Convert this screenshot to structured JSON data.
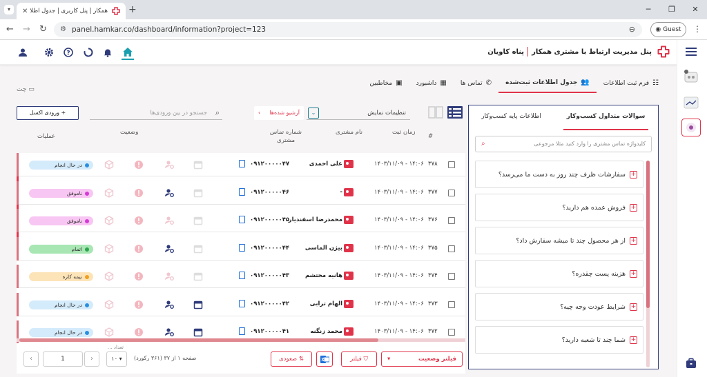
{
  "browser": {
    "tab_title": "همکار | پنل کاربری | جدول اطلاعا...",
    "url": "panel.hamkar.co/dashboard/information?project=123",
    "profile_label": "Guest"
  },
  "header": {
    "brand_title": "پنل مدیریت ارتباط با مشتری همکار",
    "company": "پناه کاویان"
  },
  "nav_tabs": [
    {
      "label": "فرم ثبت اطلاعات",
      "icon": "form-icon"
    },
    {
      "label": "جدول اطلاعات ثبت‌شده",
      "icon": "users-icon",
      "active": true
    },
    {
      "label": "تماس ها",
      "icon": "phone-icon"
    },
    {
      "label": "داشبورد",
      "icon": "dashboard-icon"
    },
    {
      "label": "مخاطبین",
      "icon": "contacts-icon"
    }
  ],
  "chat_label": "چت",
  "toolbar": {
    "excel_button": "ورودی اکسل",
    "search_placeholder": "جستجو در بین ورودی‌ها",
    "archive_label": "آرشیو شده‌ها",
    "display_settings": "تنظیمات نمایش"
  },
  "table": {
    "headers": {
      "index": "#",
      "time": "زمان ثبت",
      "name": "نام مشتری",
      "phone": "شماره تماس مشتری",
      "status": "وضعیت",
      "actions": "عملیات"
    },
    "rows": [
      {
        "id": "۳۷۸",
        "time": "۱۴۰۳/۱۱/۰۹ - ۱۴:۰۶",
        "name": "علی احمدی",
        "phone": "۰۹۱۲۰۰۰۰۰۴۷",
        "status": "در حال انجام",
        "status_color": "#2b8fe0",
        "badge_bg": "#d4ebfb"
      },
      {
        "id": "۳۷۷",
        "time": "۱۴۰۳/۱۱/۰۹ - ۱۴:۰۶",
        "name": "-",
        "phone": "۰۹۱۲۰۰۰۰۰۴۶",
        "status": "ناموفق",
        "status_color": "#d63ad6",
        "badge_bg": "#f8c6f3"
      },
      {
        "id": "۳۷۶",
        "time": "۱۴۰۳/۱۱/۰۹ - ۱۴:۰۶",
        "name": "محمدرضا اسفندیار",
        "phone": "۰۹۱۲۰۰۰۰۰۴۵",
        "status": "ناموفق",
        "status_color": "#d63ad6",
        "badge_bg": "#f8c6f3"
      },
      {
        "id": "۳۷۵",
        "time": "۱۴۰۳/۱۱/۰۹ - ۱۴:۰۶",
        "name": "بیژن الماسی",
        "phone": "۰۹۱۲۰۰۰۰۰۴۴",
        "status": "اتمام",
        "status_color": "#2ea44f",
        "badge_bg": "#a8e6b3"
      },
      {
        "id": "۳۷۴",
        "time": "۱۴۰۳/۱۱/۰۹ - ۱۴:۰۶",
        "name": "هانیه محتشم",
        "phone": "۰۹۱۲۰۰۰۰۰۴۳",
        "status": "نیمه کاره",
        "status_color": "#f0a020",
        "badge_bg": "#fde4b8"
      },
      {
        "id": "۳۷۳",
        "time": "۱۴۰۳/۱۱/۰۹ - ۱۴:۰۶",
        "name": "الهام ترابی",
        "phone": "۰۹۱۲۰۰۰۰۰۴۲",
        "status": "در حال انجام",
        "status_color": "#2b8fe0",
        "badge_bg": "#d4ebfb"
      },
      {
        "id": "۳۷۲",
        "time": "۱۴۰۳/۱۱/۰۹ - ۱۴:۰۶",
        "name": "محمد زنگنه",
        "phone": "۰۹۱۲۰۰۰۰۰۴۱",
        "status": "در حال انجام",
        "status_color": "#2b8fe0",
        "badge_bg": "#d4ebfb"
      }
    ]
  },
  "footer": {
    "status_filter": "فیلتر وضعیت",
    "filter_button": "فیلتر",
    "sort_button": "صعودی",
    "page_info": "صفحه ۱ از ۳۷ (۳۶۱ رکورد)",
    "count_label": "تعداد ...",
    "count_value": "۱۰",
    "page_value": "1"
  },
  "questions": {
    "tab_active": "سوالات متداول کسب‌وکار",
    "tab_other": "اطلاعات پایه کسب‌وکار",
    "search_placeholder": "کلیدواژه تماس مشتری را وارد کنید مثلا مرجوعی",
    "items": [
      "سفارشات ظرف چند روز به دست ما می‌رسد؟",
      "فروش عمده هم دارید؟",
      "از هر محصول چند تا میشه سفارش داد؟",
      "هزینه پست چقدره؟",
      "شرایط عودت وجه چیه؟",
      "شما چند تا شعبه دارید؟"
    ]
  },
  "colors": {
    "accent": "#e0334a",
    "navy": "#2f3b7a",
    "teal": "#1a7f8f"
  }
}
